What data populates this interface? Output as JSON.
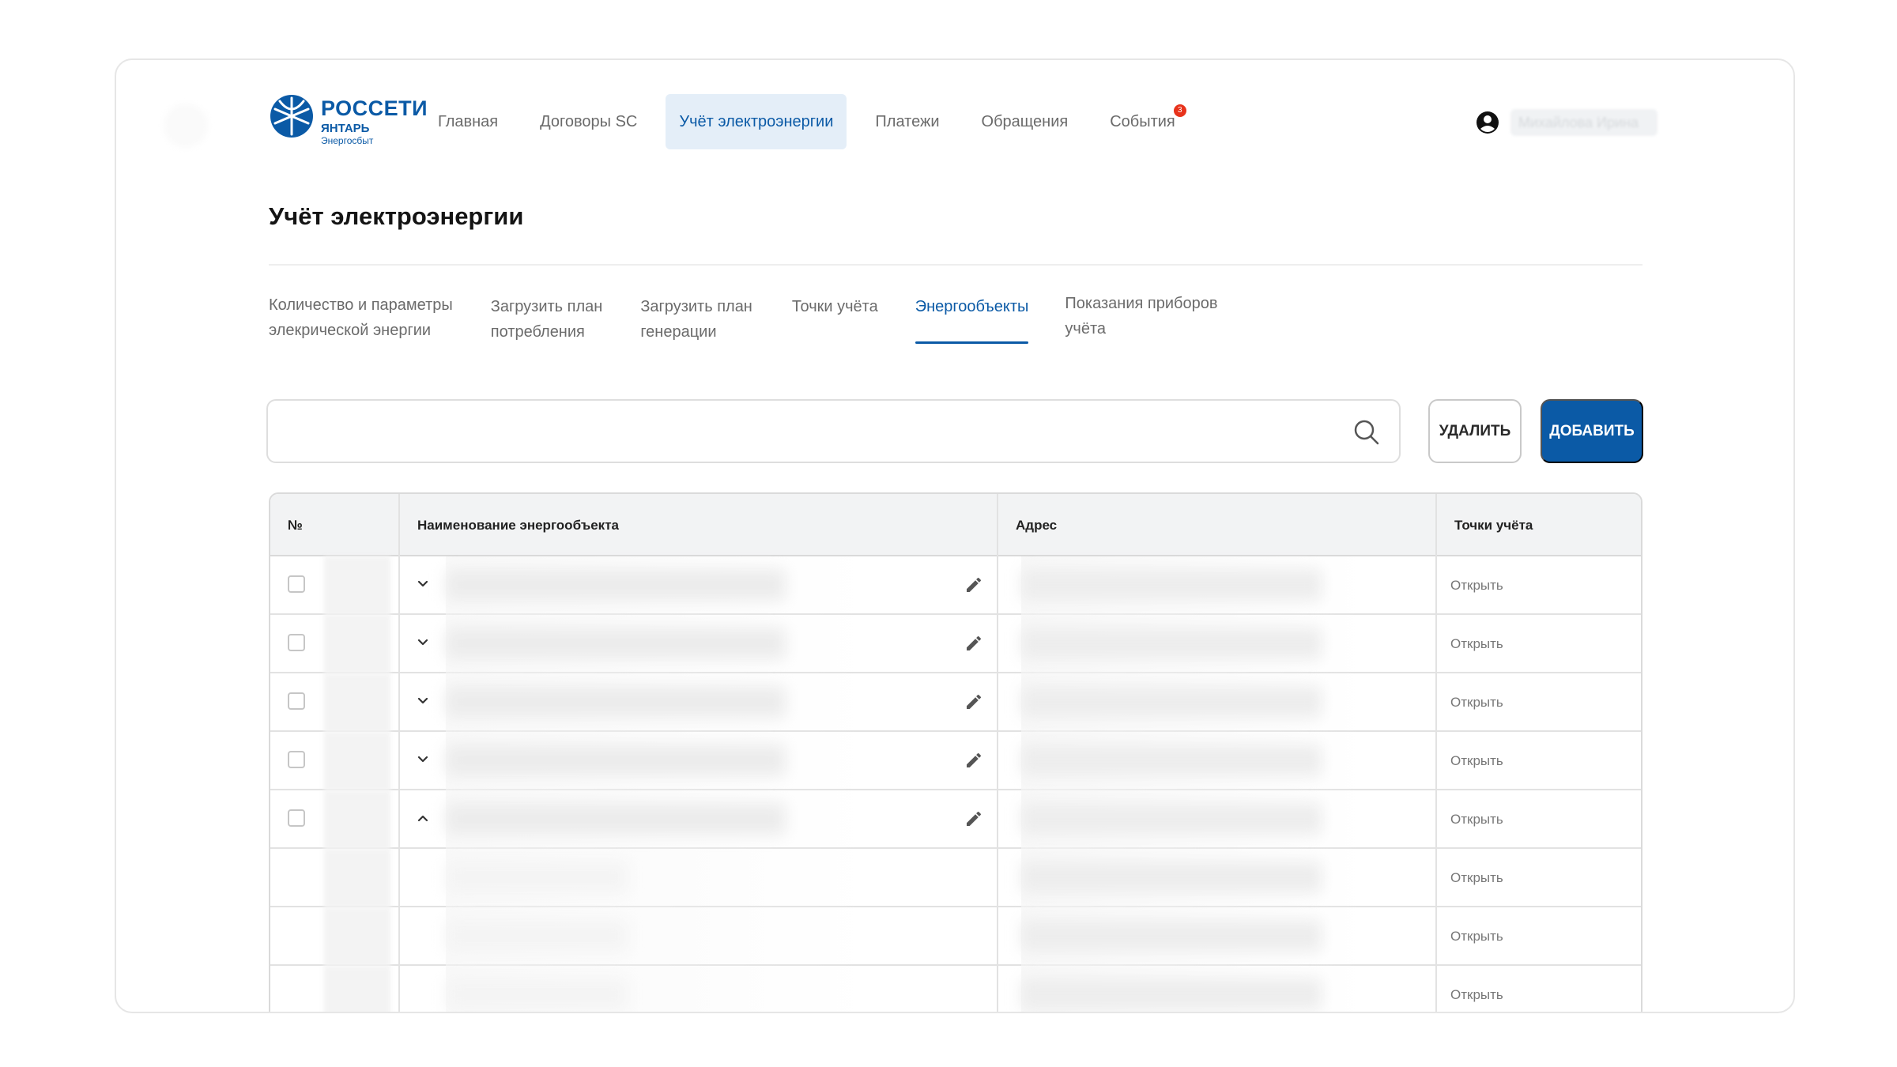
{
  "brand": {
    "title": "РОССЕТИ",
    "subtitle": "ЯНТАРЬ",
    "tagline": "Энергосбыт",
    "color": "#0b5aa6"
  },
  "nav": {
    "items": [
      {
        "label": "Главная",
        "active": false
      },
      {
        "label": "Договоры SC",
        "active": false
      },
      {
        "label": "Учёт электроэнергии",
        "active": true
      },
      {
        "label": "Платежи",
        "active": false
      },
      {
        "label": "Обращения",
        "active": false
      },
      {
        "label": "События",
        "active": false,
        "badge": "3"
      }
    ]
  },
  "user": {
    "icon": "account-circle-icon",
    "name": "Михайлова Ирина"
  },
  "page": {
    "title": "Учёт электроэнергии"
  },
  "tabs": [
    {
      "label": "Количество и параметры\nэлекрической энергии",
      "active": false
    },
    {
      "label": "Загрузить план\nпотребления",
      "active": false
    },
    {
      "label": "Загрузить план\nгенерации",
      "active": false
    },
    {
      "label": "Точки учёта",
      "active": false
    },
    {
      "label": "Энергообъекты",
      "active": true
    },
    {
      "label": "Показания приборов\nучёта",
      "active": false
    }
  ],
  "search": {
    "value": "",
    "placeholder": "",
    "icon": "search-icon"
  },
  "actions": {
    "delete_label": "Удалить",
    "add_label": "Добавить"
  },
  "table": {
    "columns": [
      "№",
      "Наименование энергообъекта",
      "Адрес",
      "Точки учёта"
    ],
    "rows": [
      {
        "checkbox": true,
        "expand": "collapsed",
        "editable": true,
        "link": "Открыть"
      },
      {
        "checkbox": true,
        "expand": "collapsed",
        "editable": true,
        "link": "Открыть"
      },
      {
        "checkbox": true,
        "expand": "collapsed",
        "editable": true,
        "link": "Открыть"
      },
      {
        "checkbox": true,
        "expand": "collapsed",
        "editable": true,
        "link": "Открыть"
      },
      {
        "checkbox": true,
        "expand": "expanded",
        "editable": true,
        "link": "Открыть"
      },
      {
        "checkbox": false,
        "expand": "none",
        "editable": false,
        "link": "Открыть"
      },
      {
        "checkbox": false,
        "expand": "none",
        "editable": false,
        "link": "Открыть"
      },
      {
        "checkbox": false,
        "expand": "none",
        "editable": false,
        "link": "Открыть"
      }
    ]
  },
  "colors": {
    "accent": "#0b5aa6",
    "active_tab_bg": "#e4eef8",
    "badge": "#e8331c",
    "header_bg": "#f2f3f4"
  }
}
